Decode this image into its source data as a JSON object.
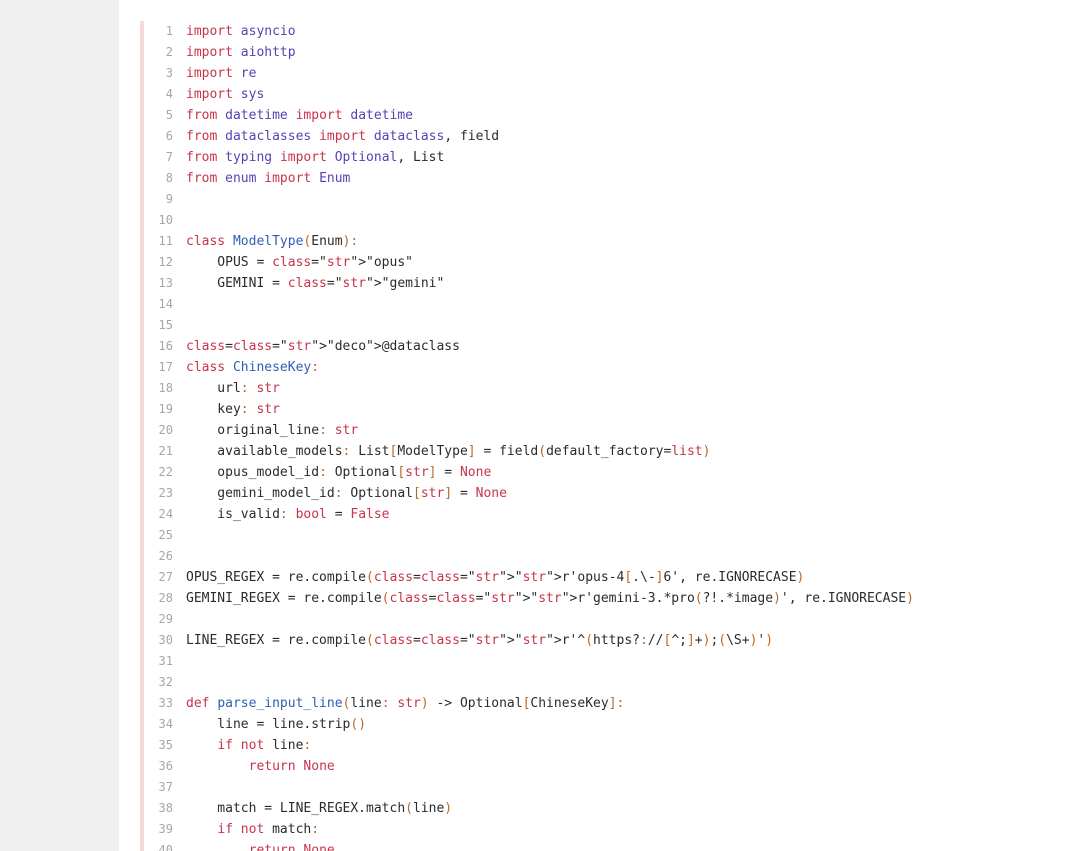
{
  "page": {
    "top_partial_text": "p, , , , , , , g , , , , , , , , , , , , , , , , , , , , , , , , , , , , , , , , , , p, , , g"
  },
  "code": {
    "language": "python",
    "lines": [
      {
        "n": "1",
        "text": "import asyncio"
      },
      {
        "n": "2",
        "text": "import aiohttp"
      },
      {
        "n": "3",
        "text": "import re"
      },
      {
        "n": "4",
        "text": "import sys"
      },
      {
        "n": "5",
        "text": "from datetime import datetime"
      },
      {
        "n": "6",
        "text": "from dataclasses import dataclass, field"
      },
      {
        "n": "7",
        "text": "from typing import Optional, List"
      },
      {
        "n": "8",
        "text": "from enum import Enum"
      },
      {
        "n": "9",
        "text": ""
      },
      {
        "n": "10",
        "text": ""
      },
      {
        "n": "11",
        "text": "class ModelType(Enum):"
      },
      {
        "n": "12",
        "text": "    OPUS = \"opus\""
      },
      {
        "n": "13",
        "text": "    GEMINI = \"gemini\""
      },
      {
        "n": "14",
        "text": ""
      },
      {
        "n": "15",
        "text": ""
      },
      {
        "n": "16",
        "text": "@dataclass"
      },
      {
        "n": "17",
        "text": "class ChineseKey:"
      },
      {
        "n": "18",
        "text": "    url: str"
      },
      {
        "n": "19",
        "text": "    key: str"
      },
      {
        "n": "20",
        "text": "    original_line: str"
      },
      {
        "n": "21",
        "text": "    available_models: List[ModelType] = field(default_factory=list)"
      },
      {
        "n": "22",
        "text": "    opus_model_id: Optional[str] = None"
      },
      {
        "n": "23",
        "text": "    gemini_model_id: Optional[str] = None"
      },
      {
        "n": "24",
        "text": "    is_valid: bool = False"
      },
      {
        "n": "25",
        "text": ""
      },
      {
        "n": "26",
        "text": ""
      },
      {
        "n": "27",
        "text": "OPUS_REGEX = re.compile(r'opus-4[.\\-]6', re.IGNORECASE)"
      },
      {
        "n": "28",
        "text": "GEMINI_REGEX = re.compile(r'gemini-3.*pro(?!.*image)', re.IGNORECASE)"
      },
      {
        "n": "29",
        "text": ""
      },
      {
        "n": "30",
        "text": "LINE_REGEX = re.compile(r'^(https?://[^;]+);(\\S+)')"
      },
      {
        "n": "31",
        "text": ""
      },
      {
        "n": "32",
        "text": ""
      },
      {
        "n": "33",
        "text": "def parse_input_line(line: str) -> Optional[ChineseKey]:"
      },
      {
        "n": "34",
        "text": "    line = line.strip()"
      },
      {
        "n": "35",
        "text": "    if not line:"
      },
      {
        "n": "36",
        "text": "        return None"
      },
      {
        "n": "37",
        "text": ""
      },
      {
        "n": "38",
        "text": "    match = LINE_REGEX.match(line)"
      },
      {
        "n": "39",
        "text": "    if not match:"
      },
      {
        "n": "40",
        "text": "        return None"
      }
    ]
  }
}
